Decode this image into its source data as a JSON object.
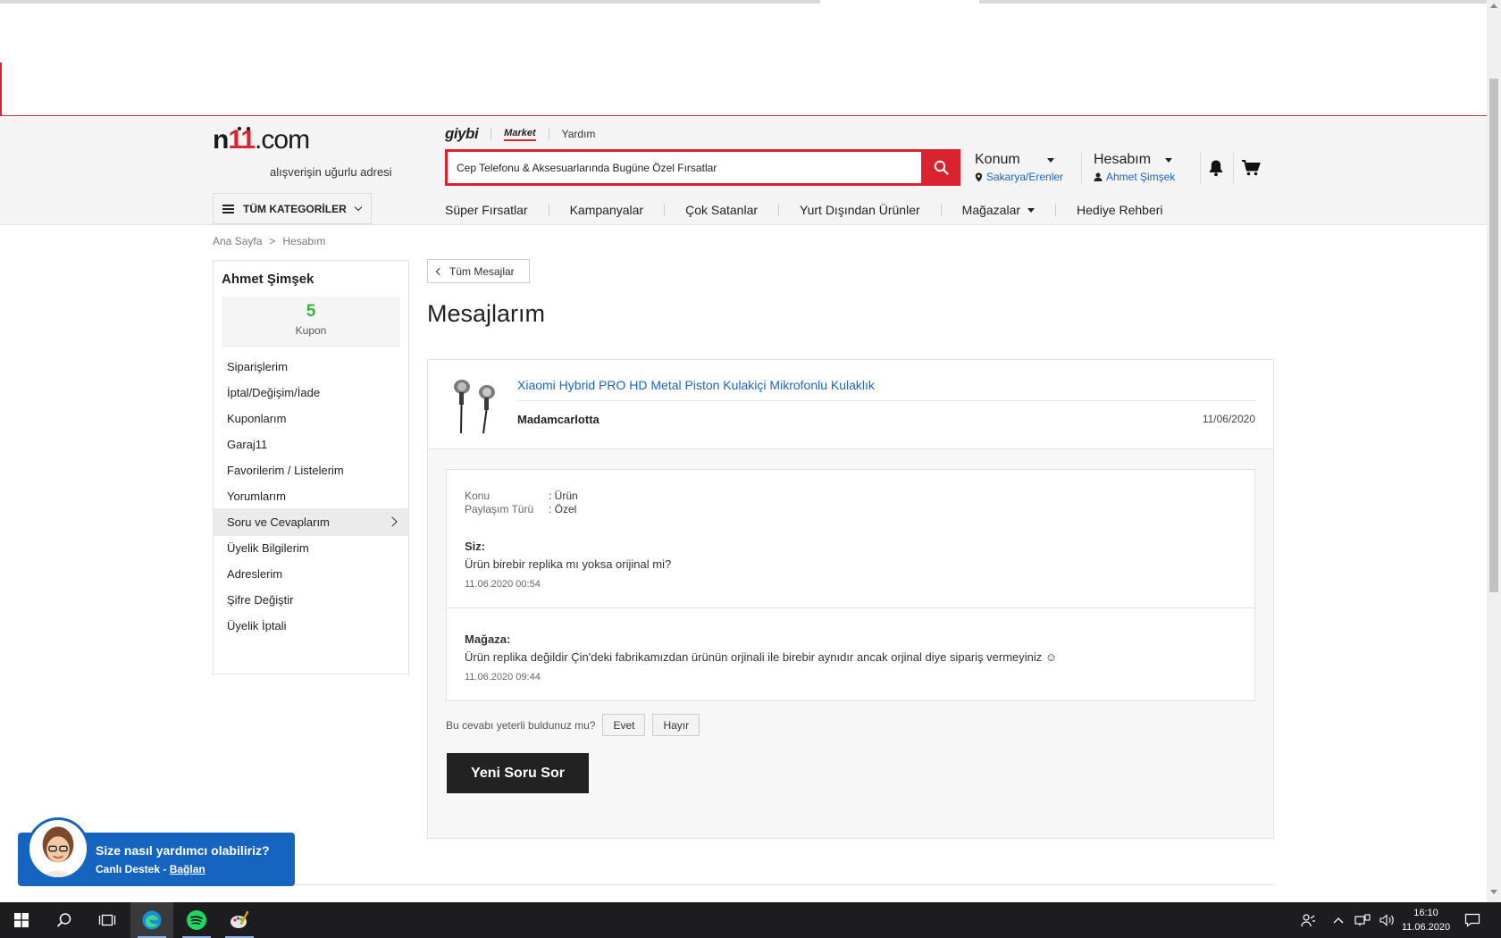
{
  "header": {
    "logo_text": "n11.com",
    "tagline": "alışverişin uğurlu adresi",
    "top_links": {
      "giybi": "giybi",
      "market": "Market",
      "help": "Yardım"
    },
    "search_value": "Cep Telefonu & Aksesuarlarında Bugüne Özel Fırsatlar",
    "location": {
      "title": "Konum",
      "value": "Sakarya/Erenler"
    },
    "account": {
      "title": "Hesabım",
      "user": "Ahmet Şimşek"
    },
    "categories_button": "TÜM KATEGORİLER",
    "nav": [
      "Süper Fırsatlar",
      "Kampanyalar",
      "Çok Satanlar",
      "Yurt Dışından Ürünler",
      "Mağazalar",
      "Hediye Rehberi"
    ]
  },
  "breadcrumb": [
    "Ana Sayfa",
    "Hesabım"
  ],
  "sidebar": {
    "user_name": "Ahmet Şimşek",
    "coupon_count": "5",
    "coupon_label": "Kupon",
    "items": [
      "Siparişlerim",
      "İptal/Değişim/İade",
      "Kuponlarım",
      "Garaj11",
      "Favorilerim / Listelerim",
      "Yorumlarım",
      "Soru ve Cevaplarım",
      "Üyelik Bilgilerim",
      "Adreslerim",
      "Şifre Değiştir",
      "Üyelik İptali"
    ],
    "active_item": "Soru ve Cevaplarım"
  },
  "content": {
    "back_button": "Tüm Mesajlar",
    "title": "Mesajlarım",
    "message": {
      "product_name": "Xiaomi Hybrid PRO HD Metal Piston Kulakiçi Mikrofonlu Kulaklık",
      "store": "Madamcarlotta",
      "date": "11/06/2020",
      "meta": [
        {
          "key": "Konu",
          "value": ": Ürün"
        },
        {
          "key": "Paylaşım Türü",
          "value": ": Özel"
        }
      ],
      "question": {
        "who": "Siz:",
        "text": "Ürün birebir replika mı yoksa orijinal mi?",
        "time": "11.06.2020 00:54"
      },
      "answer": {
        "who": "Mağaza:",
        "text": "Ürün replika değildir Çin'deki fabrikamızdan ürünün orjinali ile birebir aynıdır ancak orjinal diye sipariş vermeyiniz ☺",
        "time": "11.06.2020 09:44"
      }
    },
    "helpful_prompt": "Bu cevabı yeterli buldunuz mu?",
    "yes": "Evet",
    "no": "Hayır",
    "new_question_button": "Yeni Soru Sor"
  },
  "support": {
    "question": "Size nasıl yardımcı olabiliriz?",
    "sub_prefix": "Canlı Destek -",
    "sub_link": "Bağlan"
  },
  "taskbar": {
    "time": "16:10",
    "date": "11.06.2020"
  },
  "colors": {
    "brand_red": "#d9232e",
    "link_blue": "#1a65c6",
    "coupon_green": "#3fb241",
    "support_blue": "#1565c0"
  }
}
